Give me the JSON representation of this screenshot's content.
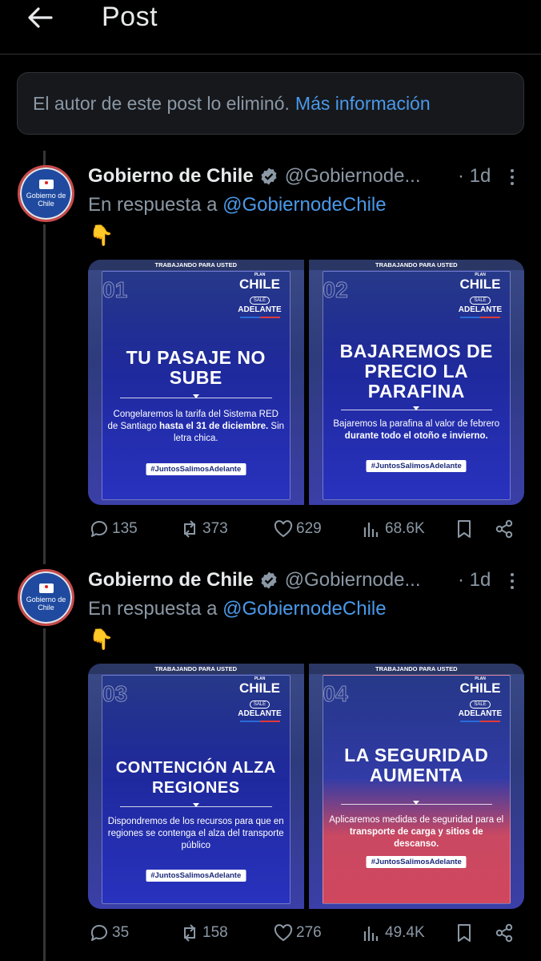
{
  "header": {
    "title": "Post",
    "back_icon": "arrow-left-icon"
  },
  "deleted_notice": {
    "text": "El autor de este post lo eliminó.",
    "link": "Más información"
  },
  "posts": [
    {
      "author": "Gobierno de Chile",
      "handle": "@Gobiernode...",
      "time": "· 1d",
      "avatar_text": "Gobierno de Chile",
      "reply_prefix": "En respuesta a",
      "reply_mention": "@GobiernodeChile",
      "emoji": "👇",
      "cards": [
        {
          "strip": "TRABAJANDO PARA USTED",
          "number": "01",
          "logo": {
            "plan": "PLAN",
            "chile": "CHILE",
            "sale": "SALE",
            "adelante": "ADELANTE"
          },
          "headline": "TU PASAJE NO SUBE",
          "body_plain": "Congelaremos la tarifa del Sistema RED de Santiago",
          "body_bold": "hasta el 31 de diciembre.",
          "body_tail": "Sin letra chica.",
          "tag": "#JuntosSalimosAdelante"
        },
        {
          "strip": "TRABAJANDO PARA USTED",
          "number": "02",
          "logo": {
            "plan": "PLAN",
            "chile": "CHILE",
            "sale": "SALE",
            "adelante": "ADELANTE"
          },
          "headline": "BAJAREMOS DE PRECIO LA PARAFINA",
          "body_plain": "Bajaremos la parafina al valor de febrero",
          "body_bold": "durante todo el otoño e invierno.",
          "body_tail": "",
          "tag": "#JuntosSalimosAdelante"
        }
      ],
      "stats": {
        "replies": "135",
        "reposts": "373",
        "likes": "629",
        "views": "68.6K"
      }
    },
    {
      "author": "Gobierno de Chile",
      "handle": "@Gobiernode...",
      "time": "· 1d",
      "avatar_text": "Gobierno de Chile",
      "reply_prefix": "En respuesta a",
      "reply_mention": "@GobiernodeChile",
      "emoji": "👇",
      "cards": [
        {
          "strip": "TRABAJANDO PARA USTED",
          "number": "03",
          "logo": {
            "plan": "PLAN",
            "chile": "CHILE",
            "sale": "SALE",
            "adelante": "ADELANTE"
          },
          "headline": "CONTENCIÓN ALZA REGIONES",
          "body_plain": "Dispondremos de los recursos para que en regiones se contenga el alza del transporte público",
          "body_bold": "",
          "body_tail": "",
          "tag": "#JuntosSalimosAdelante"
        },
        {
          "strip": "TRABAJANDO PARA USTED",
          "number": "04",
          "logo": {
            "plan": "PLAN",
            "chile": "CHILE",
            "sale": "SALE",
            "adelante": "ADELANTE"
          },
          "headline": "LA SEGURIDAD AUMENTA",
          "body_plain": "Aplicaremos medidas de seguridad para el",
          "body_bold": "transporte de carga y sitios de descanso.",
          "body_tail": "",
          "tag": "#JuntosSalimosAdelante"
        }
      ],
      "stats": {
        "replies": "35",
        "reposts": "158",
        "likes": "276",
        "views": "49.4K"
      }
    }
  ],
  "colors": {
    "background": "#000000",
    "link": "#4a99e9",
    "muted": "#8b98a5",
    "verified": "#8b98a5"
  }
}
